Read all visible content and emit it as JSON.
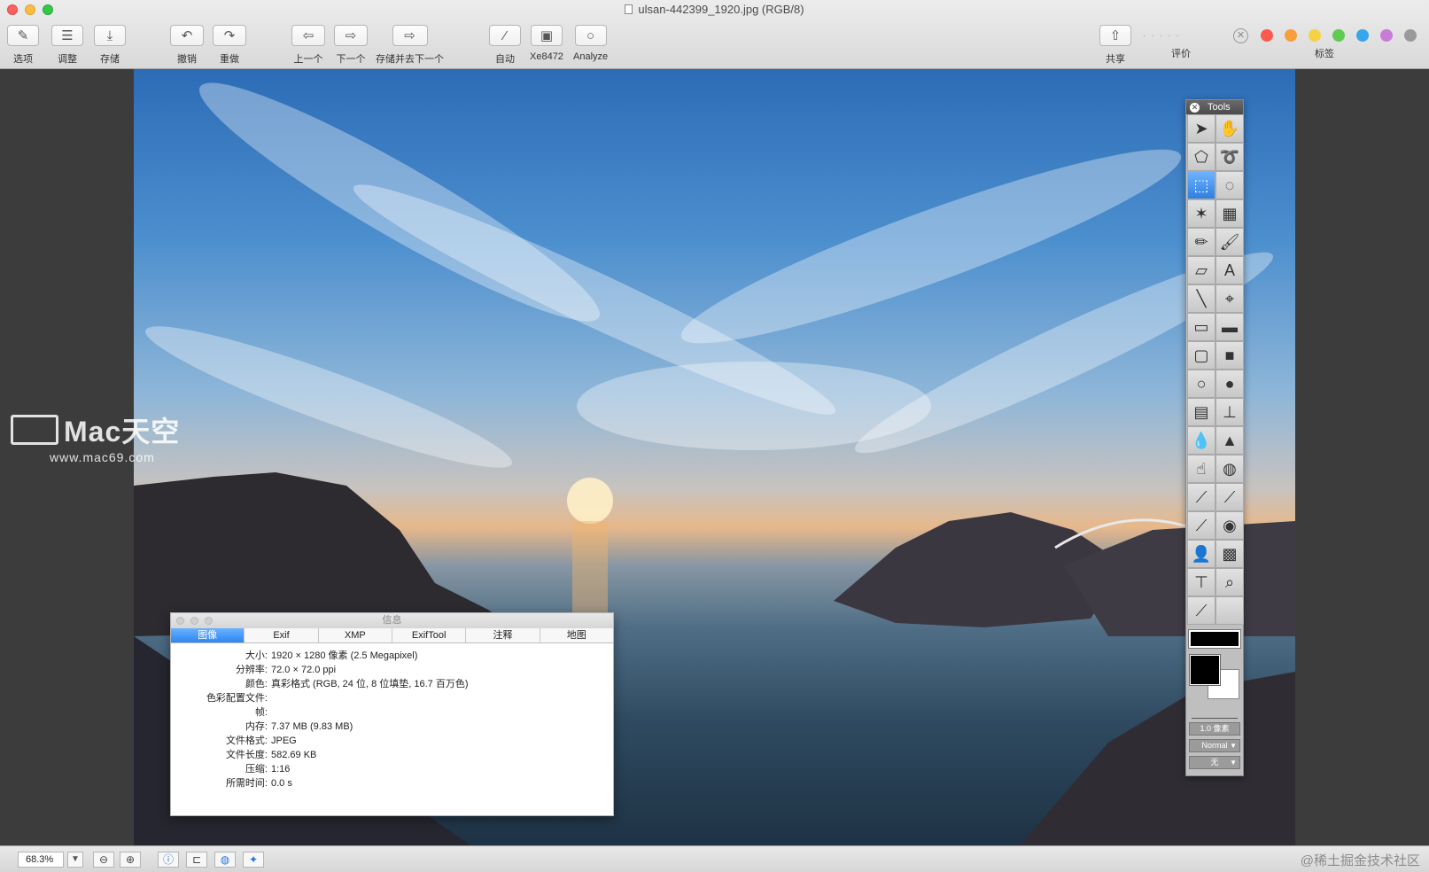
{
  "window": {
    "title": "ulsan-442399_1920.jpg (RGB/8)"
  },
  "toolbar": {
    "items": [
      {
        "label": "选项",
        "icon": "options-icon"
      },
      {
        "label": "调整",
        "icon": "adjust-icon"
      },
      {
        "label": "存储",
        "icon": "save-icon"
      },
      {
        "label": "撤销",
        "icon": "undo-icon"
      },
      {
        "label": "重做",
        "icon": "redo-icon"
      },
      {
        "label": "上一个",
        "icon": "previous-icon"
      },
      {
        "label": "下一个",
        "icon": "next-icon"
      },
      {
        "label": "存储并去下一个",
        "icon": "save-next-icon"
      },
      {
        "label": "自动",
        "icon": "magic-wand-icon"
      },
      {
        "label": "Xe8472",
        "icon": "image-icon"
      },
      {
        "label": "Analyze",
        "icon": "bulb-icon"
      },
      {
        "label": "共享",
        "icon": "share-icon"
      },
      {
        "label": "评价",
        "icon": "rating-icon"
      },
      {
        "label": "标签",
        "icon": "tag-icon"
      }
    ],
    "tag_colors": [
      "#fc5a4f",
      "#f99e3a",
      "#f5d143",
      "#5fcb4f",
      "#38a6ec",
      "#c87bd9",
      "#9a9a9a"
    ]
  },
  "watermark": {
    "brand": "Mac天空",
    "url": "www.mac69.com"
  },
  "info_panel": {
    "title": "信息",
    "tabs": [
      "图像",
      "Exif",
      "XMP",
      "ExifTool",
      "注释",
      "地图"
    ],
    "active_tab": "图像",
    "rows": [
      {
        "key": "大小:",
        "value": "1920 × 1280 像素 (2.5 Megapixel)"
      },
      {
        "key": "分辨率:",
        "value": "72.0 × 72.0 ppi"
      },
      {
        "key": "颜色:",
        "value": "真彩格式 (RGB, 24 位, 8 位填垫, 16.7 百万色)"
      },
      {
        "key": "色彩配置文件:",
        "value": ""
      },
      {
        "key": "帧:",
        "value": ""
      },
      {
        "key": "内存:",
        "value": "7.37 MB (9.83 MB)"
      },
      {
        "key": "文件格式:",
        "value": "JPEG"
      },
      {
        "key": "文件长度:",
        "value": "582.69 KB"
      },
      {
        "key": "压缩:",
        "value": "1:16"
      },
      {
        "key": "所需时间:",
        "value": "0.0 s"
      }
    ]
  },
  "tools": {
    "title": "Tools",
    "line_width": "1.0 像素",
    "blend_mode": "Normal",
    "pattern": "无",
    "icons": [
      "arrow-select-icon",
      "hand-icon",
      "polygon-lasso-icon",
      "lasso-icon",
      "rect-select-icon",
      "ellipse-select-icon",
      "magic-wand-icon",
      "checker-icon",
      "pencil-icon",
      "brush-icon",
      "eraser-icon",
      "text-icon",
      "line-icon",
      "crosshair-icon",
      "rect-icon",
      "rect-fill-icon",
      "round-rect-icon",
      "round-rect-fill-icon",
      "ellipse-icon",
      "ellipse-fill-icon",
      "bucket-icon",
      "stamp-icon",
      "drop-icon",
      "sharpen-icon",
      "smudge-icon",
      "sponge-icon",
      "dodge-icon",
      "burn-icon",
      "airbrush-icon",
      "red-eye-icon",
      "person-icon",
      "pattern-icon",
      "ruler-icon",
      "zoom-tool-icon",
      "eyedropper-icon",
      "empty-icon"
    ]
  },
  "statusbar": {
    "zoom": "68.3%",
    "credit": "@稀土掘金技术社区"
  }
}
